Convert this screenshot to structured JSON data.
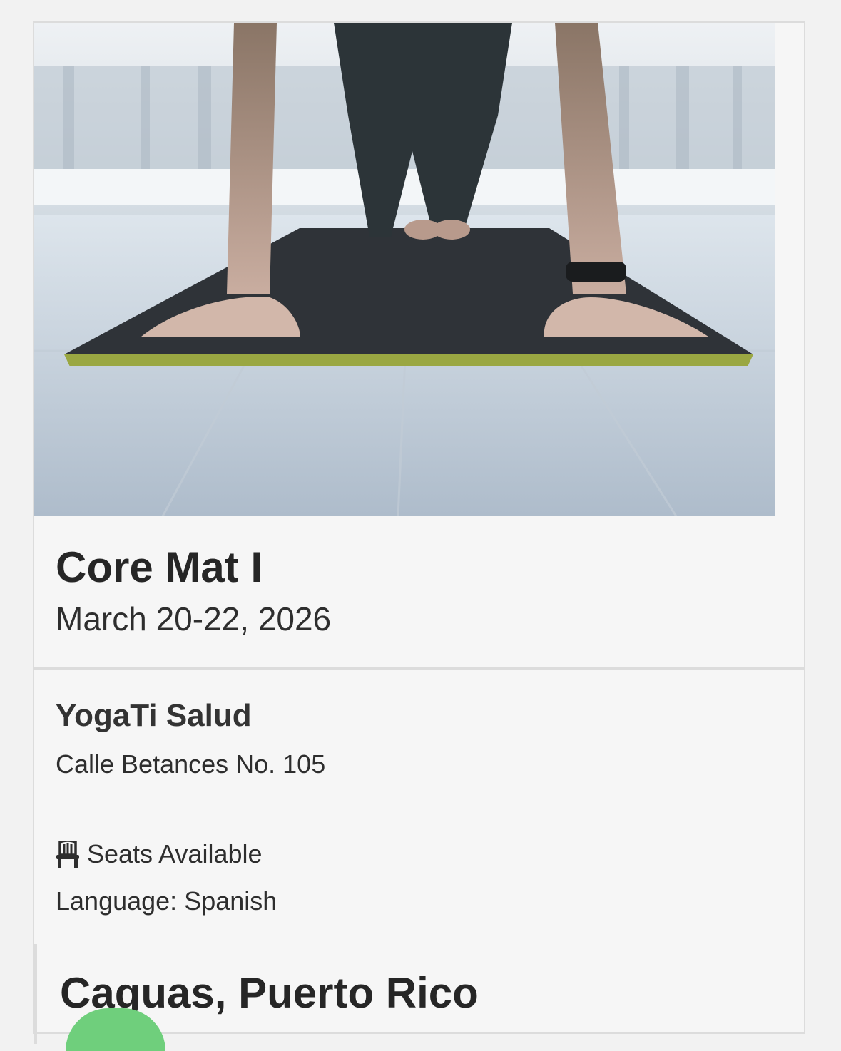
{
  "event": {
    "title": "Core Mat I",
    "date": "March 20-22, 2026"
  },
  "venue": {
    "name": "YogaTi Salud",
    "address": "Calle Betances No. 105"
  },
  "details": {
    "seats_label": "Seats Available",
    "language_label": "Language: Spanish"
  },
  "location": {
    "city": "Caguas, Puerto Rico"
  },
  "colors": {
    "card_background": "#f6f6f6",
    "border": "#dcdcdc",
    "text": "#2b2b2b",
    "accent_green": "#6fcf7c"
  },
  "icons": {
    "seats": "chair-icon"
  }
}
